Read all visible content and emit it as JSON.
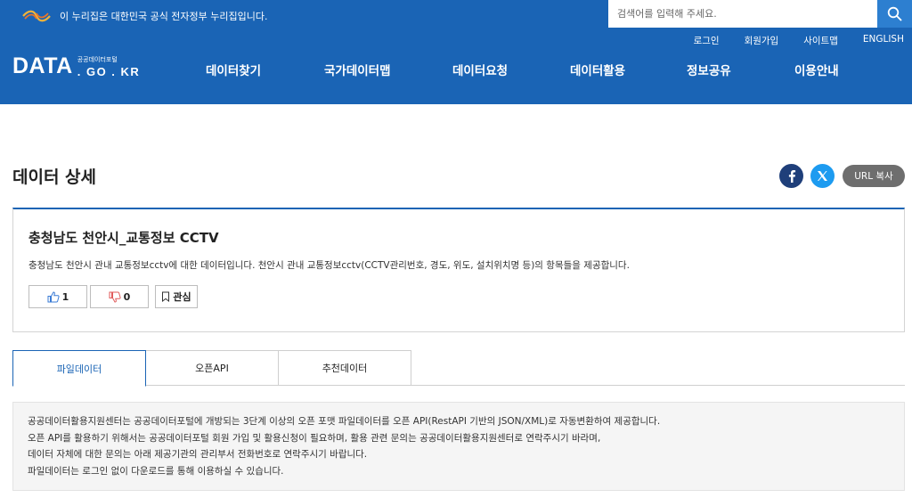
{
  "header": {
    "gov_notice": "이 누리집은 대한민국 공식 전자정부 누리집입니다.",
    "search_placeholder": "검색어를 입력해 주세요.",
    "util_links": [
      "로그인",
      "회원가입",
      "사이트맵",
      "ENGLISH"
    ],
    "logo": {
      "main": "DATA",
      "sub": "공공데이터포털",
      "domain": ". GO . KR"
    },
    "nav": [
      "데이터찾기",
      "국가데이터맵",
      "데이터요청",
      "데이터활용",
      "정보공유",
      "이용안내"
    ]
  },
  "page": {
    "title": "데이터 상세",
    "share": {
      "facebook_icon": "facebook-icon",
      "x_icon": "x-twitter-icon",
      "url_copy_label": "URL 복사"
    }
  },
  "dataset": {
    "title": "충청남도 천안시_교통정보 CCTV",
    "description": "충청남도 천안시 관내 교통정보cctv에 대한 데이터입니다. 천안시 관내 교통정보cctv(CCTV관리번호, 경도, 위도, 설치위치명 등)의 항목들을 제공합니다.",
    "likes": "1",
    "dislikes": "0",
    "interest_label": "관심"
  },
  "tabs": [
    {
      "label": "파일데이터",
      "active": true
    },
    {
      "label": "오픈API",
      "active": false
    },
    {
      "label": "추천데이터",
      "active": false
    }
  ],
  "notice": [
    "공공데이터활용지원센터는 공공데이터포털에 개방되는 3단계 이상의 오픈 포맷 파일데이터를 오픈 API(RestAPI 기반의 JSON/XML)로 자동변환하여 제공합니다.",
    "오픈 API를 활용하기 위해서는 공공데이터포털 회원 가입 및 활용신청이 필요하며, 활용 관련 문의는 공공데이터활용지원센터로 연락주시기 바라며,",
    "데이터 자체에 대한 문의는 아래 제공기관의 관리부서 전화번호로 연락주시기 바랍니다.",
    "파일데이터는 로그인 없이 다운로드를 통해 이용하실 수 있습니다."
  ],
  "colors": {
    "brand": "#1a64b5",
    "facebook": "#1f3f7a",
    "x": "#1d9bf0",
    "url_button": "#6e6e6e"
  }
}
